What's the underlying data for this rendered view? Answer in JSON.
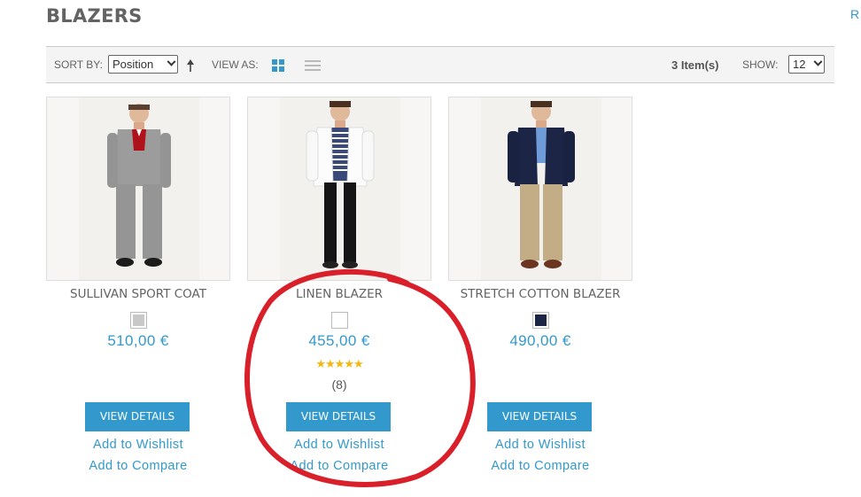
{
  "page": {
    "title": "BLAZERS",
    "edge_link": "R"
  },
  "toolbar": {
    "sort_label": "SORT BY:",
    "sort_value": "Position",
    "view_label": "VIEW AS:",
    "item_count": "3 Item(s)",
    "show_label": "SHOW:",
    "show_value": "12",
    "accent_color": "#3399cc"
  },
  "products": [
    {
      "name": "SULLIVAN SPORT COAT",
      "price": "510,00 €",
      "swatch_color": "#c8c8c8",
      "button": "VIEW DETAILS",
      "wishlist": "Add to Wishlist",
      "compare": "Add to Compare"
    },
    {
      "name": "LINEN BLAZER",
      "price": "455,00 €",
      "swatch_color": "#ffffff",
      "rating_stars": 5,
      "reviews": "(8)",
      "button": "VIEW DETAILS",
      "wishlist": "Add to Wishlist",
      "compare": "Add to Compare"
    },
    {
      "name": "STRETCH COTTON BLAZER",
      "price": "490,00 €",
      "swatch_color": "#1c2546",
      "button": "VIEW DETAILS",
      "wishlist": "Add to Wishlist",
      "compare": "Add to Compare"
    }
  ],
  "annotation": {
    "color": "#d9202a"
  }
}
